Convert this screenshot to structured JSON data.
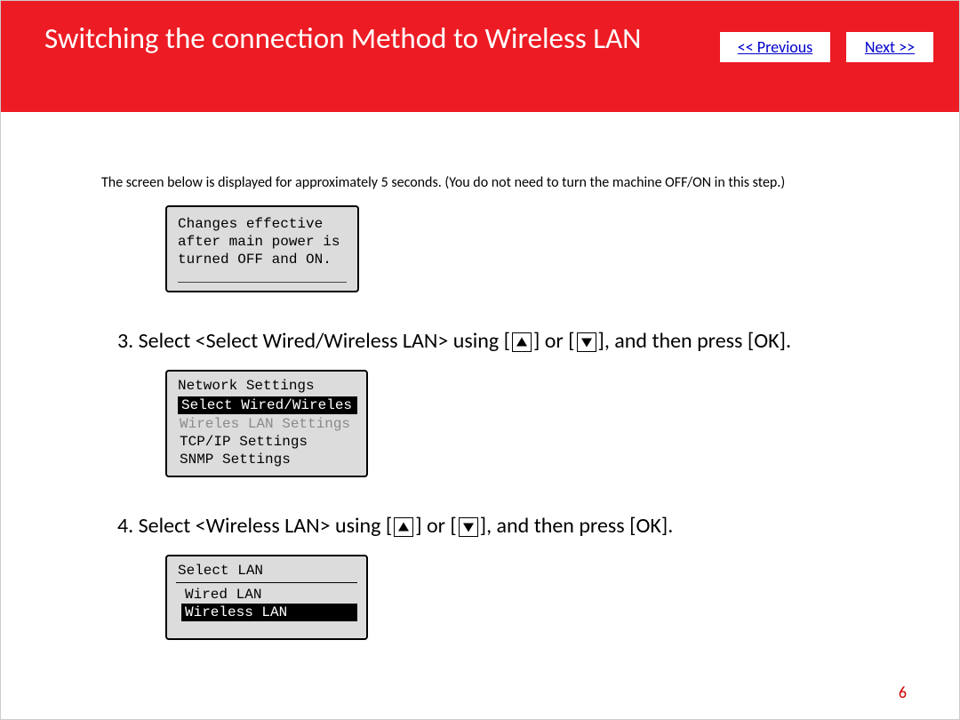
{
  "header": {
    "title": "Switching the connection Method to Wireless LAN",
    "prev_label": "<< Previous",
    "next_label": "Next >>"
  },
  "note": "The screen below is displayed for approximately 5 seconds. (You do not need to turn the machine OFF/ON in this step.)",
  "lcd1": {
    "line1": "Changes effective",
    "line2": "after main power is",
    "line3": "turned OFF and ON."
  },
  "step3": {
    "pre": "3. Select <Select Wired/Wireless LAN> using [",
    "mid": "] or [",
    "post": "], and then press [OK]."
  },
  "lcd2": {
    "title": "Network Settings",
    "selected": "Select Wired/Wireles",
    "dim": "Wireles LAN Settings",
    "item1": "TCP/IP Settings",
    "item2": "SNMP Settings"
  },
  "step4": {
    "pre": "4. Select <Wireless LAN> using [",
    "mid": "] or [",
    "post": "], and then press [OK]."
  },
  "lcd3": {
    "title": "Select LAN",
    "item1": "Wired LAN",
    "selected": "Wireless LAN"
  },
  "page_number": "6"
}
